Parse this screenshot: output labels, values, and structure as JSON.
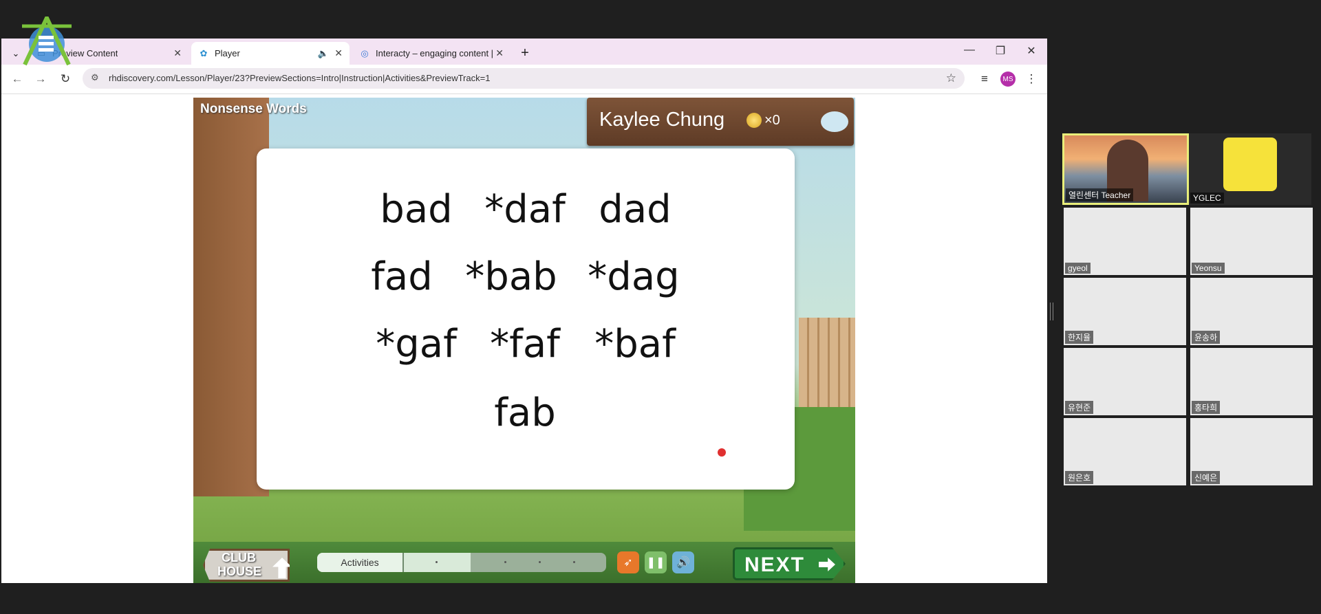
{
  "browser": {
    "tabs": [
      {
        "label": "Preview Content",
        "favicon": "document-icon",
        "active": false
      },
      {
        "label": "Player",
        "favicon": "butterfly-icon",
        "active": true,
        "audio": true
      },
      {
        "label": "Interacty – engaging content |",
        "favicon": "globe-icon",
        "active": false
      }
    ],
    "new_tab": "+",
    "url": "rhdiscovery.com/Lesson/Player/23?PreviewSections=Intro|Instruction|Activities&PreviewTrack=1",
    "profile_initials": "MS",
    "accent_color": "#f3e3f3"
  },
  "lesson": {
    "section_title": "Nonsense Words",
    "student_name": "Kaylee Chung",
    "coin_count": "×0",
    "words": [
      [
        "bad",
        "*daf",
        "dad"
      ],
      [
        "fad",
        "*bab",
        "*dag"
      ],
      [
        "*gaf",
        "*faf",
        "*baf"
      ],
      [
        "fab"
      ]
    ],
    "clubhouse_line1": "CLUB",
    "clubhouse_line2": "HOUSE",
    "progress_label": "Activities",
    "progress_fraction": 0.53,
    "next_label": "NEXT"
  },
  "participants": [
    {
      "name": "열린센터 Teacher",
      "highlight": true
    },
    {
      "name": "YGLEC"
    },
    {
      "name": "gyeol"
    },
    {
      "name": "Yeonsu"
    },
    {
      "name": "한지율"
    },
    {
      "name": "윤송하"
    },
    {
      "name": "유현준"
    },
    {
      "name": "홍타희"
    },
    {
      "name": "원은호"
    },
    {
      "name": "신예은"
    }
  ]
}
